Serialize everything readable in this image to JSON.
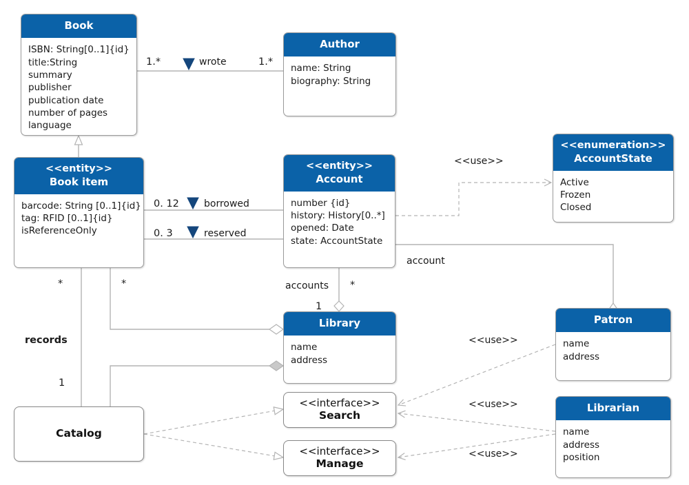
{
  "diagram": {
    "type": "uml-class-diagram",
    "title": "Library system UML class diagram",
    "accent_color": "#0b62a8",
    "header_text_color": "#ffffff",
    "background": "#ffffff",
    "edge_color": "#b3b3b3"
  },
  "nodes": {
    "book": {
      "name": "Book",
      "stereotype": "",
      "attributes": [
        "ISBN: String[0..1]{id}",
        "title:String",
        "summary",
        "publisher",
        "publication date",
        "number of pages",
        "language"
      ]
    },
    "author": {
      "name": "Author",
      "stereotype": "",
      "attributes": [
        "name: String",
        "biography: String"
      ]
    },
    "book_item": {
      "name": "Book item",
      "stereotype": "<<entity>>",
      "attributes": [
        "barcode: String [0..1]{id}",
        "tag: RFID [0..1]{id}",
        "isReferenceOnly"
      ]
    },
    "account": {
      "name": "Account",
      "stereotype": "<<entity>>",
      "attributes": [
        "number {id}",
        "history: History[0..*]",
        "opened: Date",
        "state: AccountState"
      ]
    },
    "account_state": {
      "name": "AccountState",
      "stereotype": "<<enumeration>>",
      "attributes": [
        "Active",
        "Frozen",
        "Closed"
      ]
    },
    "library": {
      "name": "Library",
      "stereotype": "",
      "attributes": [
        "name",
        "address"
      ]
    },
    "patron": {
      "name": "Patron",
      "stereotype": "",
      "attributes": [
        "name",
        "address"
      ]
    },
    "librarian": {
      "name": "Librarian",
      "stereotype": "",
      "attributes": [
        "name",
        "address",
        "position"
      ]
    },
    "catalog": {
      "name": "Catalog",
      "stereotype": ""
    },
    "search": {
      "name": "Search",
      "stereotype": "<<interface>>"
    },
    "manage": {
      "name": "Manage",
      "stereotype": "<<interface>>"
    }
  },
  "edge_labels": {
    "wrote_name": "wrote",
    "wrote_src_mult": "1.*",
    "wrote_dst_mult": "1.*",
    "borrowed_name": "borrowed",
    "borrowed_mult": "0. 12",
    "reserved_name": "reserved",
    "reserved_mult": "0. 3",
    "use_account_state": "<<use>>",
    "account_role": "account",
    "accounts_role": "accounts",
    "accounts_mult_many": "*",
    "accounts_mult_one": "1",
    "records_role": "records",
    "records_mult_many": "*",
    "records_mult_one": "1",
    "bookitem_library_mult": "*",
    "use_patron_search": "<<use>>",
    "use_librarian_search": "<<use>>",
    "use_librarian_manage": "<<use>>"
  }
}
